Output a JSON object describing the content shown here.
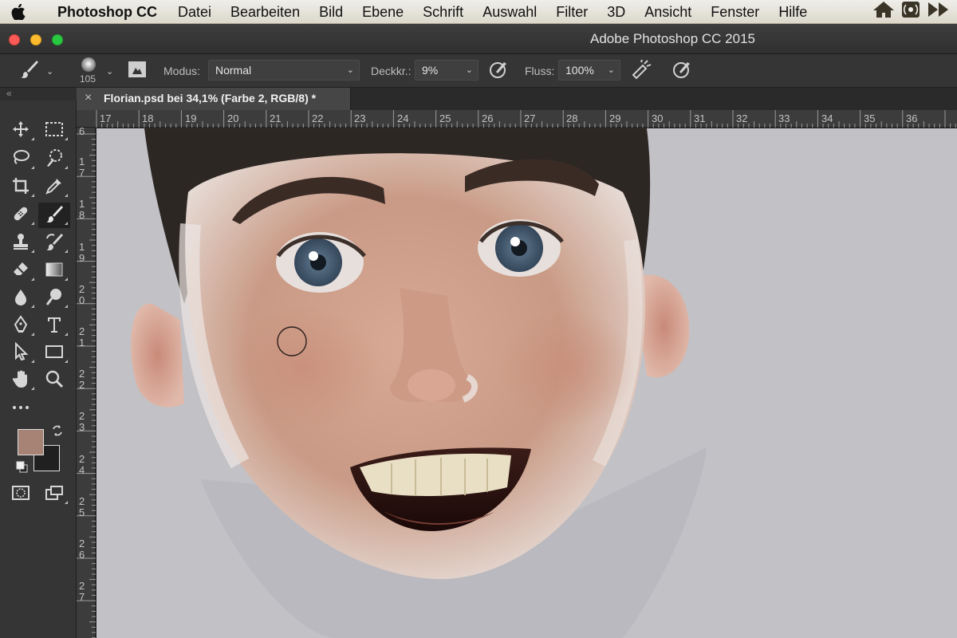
{
  "menubar": {
    "app_name": "Photoshop CC",
    "items": [
      "Datei",
      "Bearbeiten",
      "Bild",
      "Ebene",
      "Schrift",
      "Auswahl",
      "Filter",
      "3D",
      "Ansicht",
      "Fenster",
      "Hilfe"
    ]
  },
  "window": {
    "title": "Adobe Photoshop CC 2015"
  },
  "options": {
    "brush_size": "105",
    "mode_label": "Modus:",
    "mode_value": "Normal",
    "opacity_label": "Deckkr.:",
    "opacity_value": "9%",
    "flow_label": "Fluss:",
    "flow_value": "100%"
  },
  "document": {
    "tab_title": "Florian.psd bei 34,1% (Farbe 2, RGB/8) *",
    "close_glyph": "×"
  },
  "panel": {
    "collapse_glyph": "«"
  },
  "rulers": {
    "top": [
      "17",
      "18",
      "19",
      "20",
      "21",
      "22",
      "23",
      "24",
      "25",
      "26",
      "27",
      "28",
      "29",
      "30",
      "31",
      "32",
      "33",
      "34",
      "35",
      "36"
    ],
    "left": [
      "6",
      "1\n7",
      "1\n8",
      "1\n9",
      "2\n0",
      "2\n1",
      "2\n2",
      "2\n3",
      "2\n4",
      "2\n5",
      "2\n6",
      "2\n7"
    ]
  },
  "colors": {
    "foreground": "#a78375",
    "background": "#202020",
    "canvas_bg": "#c1c1c6",
    "ui_panel": "#353535"
  },
  "icons": {
    "apple": "apple-icon",
    "brush": "brush-icon",
    "move": "move-icon",
    "marquee": "rect-marquee-icon",
    "lasso": "lasso-icon",
    "quick_select": "quick-select-icon",
    "crop": "crop-icon",
    "eyedropper": "eyedropper-icon",
    "healing": "healing-icon",
    "stamp": "clone-stamp-icon",
    "history_brush": "history-brush-icon",
    "eraser": "eraser-icon",
    "gradient": "gradient-icon",
    "blur": "blur-icon",
    "dodge": "dodge-icon",
    "pen": "pen-icon",
    "type": "type-icon",
    "path_select": "path-select-icon",
    "shape": "rectangle-icon",
    "hand": "hand-icon",
    "zoom": "zoom-icon"
  }
}
